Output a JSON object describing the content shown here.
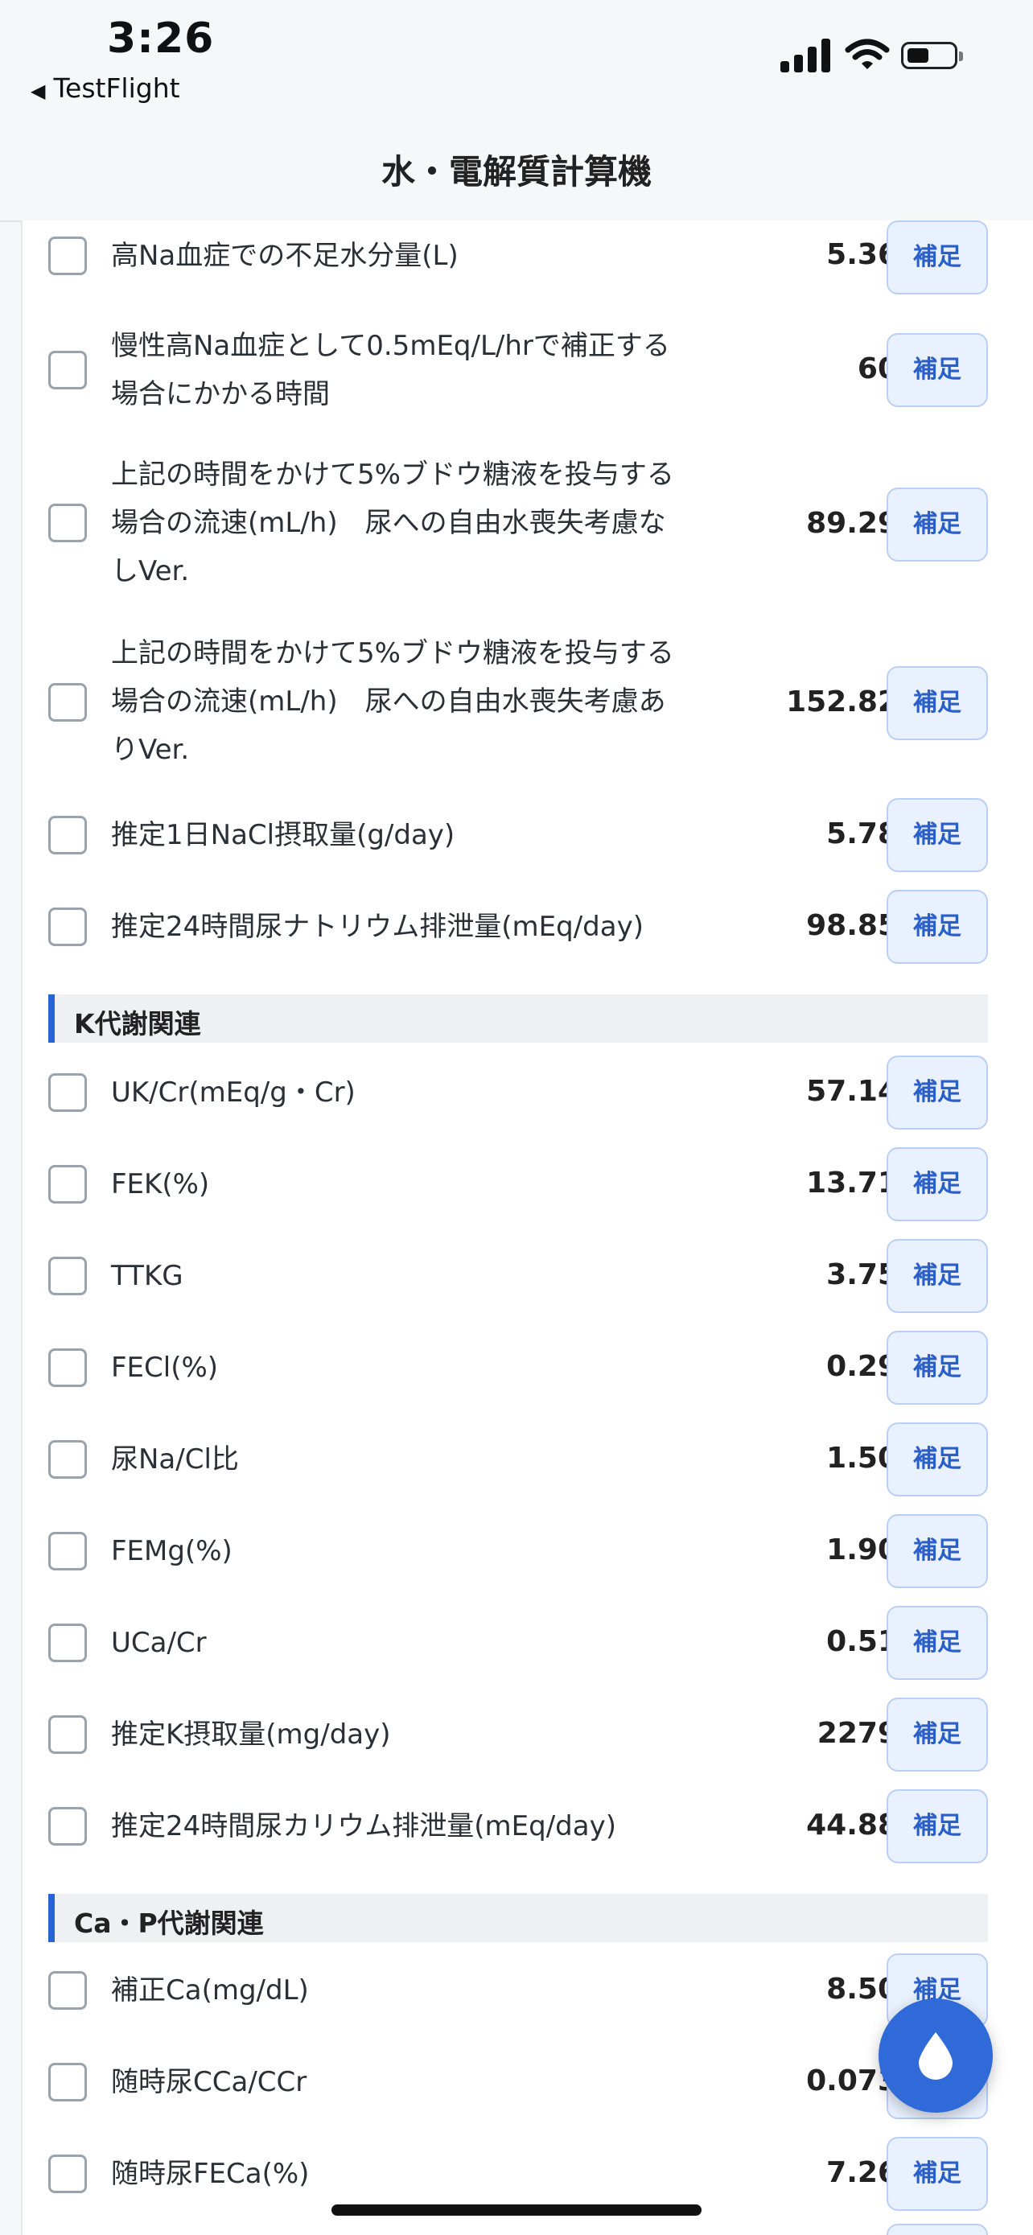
{
  "status_bar": {
    "time": "3:26",
    "back_app": "TestFlight"
  },
  "nav": {
    "title": "水・電解質計算機"
  },
  "button_label": "補足",
  "sections": [
    {
      "title": "K代謝関連"
    },
    {
      "title": "Ca・P代謝関連"
    }
  ],
  "rows": [
    {
      "label": "高Na血症での不足水分量(L)",
      "value": "5.36"
    },
    {
      "label": "慢性高Na血症として0.5mEq/L/hrで補正する場合にかかる時間",
      "value": "60"
    },
    {
      "label": "上記の時間をかけて5%ブドウ糖液を投与する場合の流速(mL/h)　尿への自由水喪失考慮なしVer.",
      "value": "89.29"
    },
    {
      "label": "上記の時間をかけて5%ブドウ糖液を投与する場合の流速(mL/h)　尿への自由水喪失考慮ありVer.",
      "value": "152.82"
    },
    {
      "label": "推定1日NaCl摂取量(g/day)",
      "value": "5.78"
    },
    {
      "label": "推定24時間尿ナトリウム排泄量(mEq/day)",
      "value": "98.85"
    },
    {
      "label": "UK/Cr(mEq/g・Cr)",
      "value": "57.14"
    },
    {
      "label": "FEK(%)",
      "value": "13.71"
    },
    {
      "label": "TTKG",
      "value": "3.75"
    },
    {
      "label": "FECl(%)",
      "value": "0.29"
    },
    {
      "label": "尿Na/Cl比",
      "value": "1.50"
    },
    {
      "label": "FEMg(%)",
      "value": "1.90"
    },
    {
      "label": "UCa/Cr",
      "value": "0.51"
    },
    {
      "label": "推定K摂取量(mg/day)",
      "value": "2279"
    },
    {
      "label": "推定24時間尿カリウム排泄量(mEq/day)",
      "value": "44.88"
    },
    {
      "label": "補正Ca(mg/dL)",
      "value": "8.50"
    },
    {
      "label": "随時尿CCa/CCr",
      "value": "0.073"
    },
    {
      "label": "随時尿FECa(%)",
      "value": "7.26"
    }
  ],
  "colors": {
    "accent": "#2a63d6",
    "fab": "#2f6ad8"
  },
  "fab_icon": "water-drop-icon"
}
